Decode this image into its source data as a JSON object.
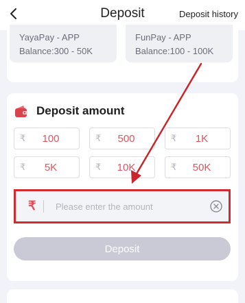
{
  "header": {
    "title": "Deposit",
    "history_label": "Deposit history"
  },
  "methods": [
    {
      "name": "YayaPay - APP",
      "balance": "Balance:300 - 50K"
    },
    {
      "name": "FunPay - APP",
      "balance": "Balance:100 - 100K"
    }
  ],
  "amount_section": {
    "title": "Deposit amount",
    "currency_symbol": "₹",
    "chips": [
      "100",
      "500",
      "1K",
      "5K",
      "10K",
      "50K"
    ],
    "input_placeholder": "Please enter the amount",
    "deposit_label": "Deposit"
  },
  "colors": {
    "accent": "#e0555f",
    "highlight": "#d22a2e",
    "button_disabled": "#c9cad6"
  },
  "icons": {
    "back": "back-arrow-icon",
    "wallet": "wallet-icon",
    "rupee": "rupee-icon",
    "clear": "clear-icon"
  }
}
